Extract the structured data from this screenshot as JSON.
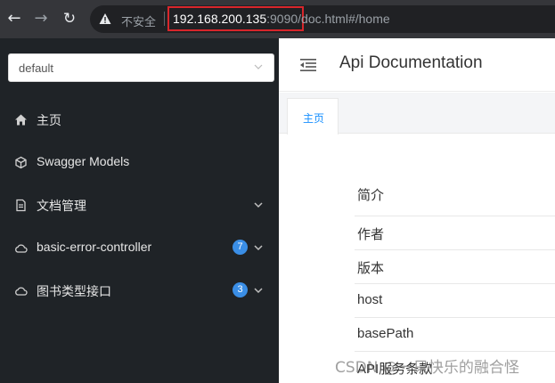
{
  "browser": {
    "insecure_label": "不安全",
    "url_host": "192.168.200.135",
    "url_port": ":9090",
    "url_path": "/doc.html#/home"
  },
  "sidebar": {
    "group_select_value": "default",
    "items": [
      {
        "label": "主页",
        "icon": "home-icon"
      },
      {
        "label": "Swagger Models",
        "icon": "cube-icon"
      },
      {
        "label": "文档管理",
        "icon": "document-icon",
        "expandable": true
      },
      {
        "label": "basic-error-controller",
        "icon": "cloud-icon",
        "badge": "7",
        "expandable": true
      },
      {
        "label": "图书类型接口",
        "icon": "cloud-icon",
        "badge": "3",
        "expandable": true
      }
    ]
  },
  "main": {
    "title": "Api Documentation",
    "tabs": [
      {
        "label": "主页"
      }
    ],
    "info_rows": [
      {
        "label": "简介"
      },
      {
        "label": "作者"
      },
      {
        "label": "版本"
      },
      {
        "label": "host"
      },
      {
        "label": "basePath"
      },
      {
        "label": "API服务条款"
      }
    ]
  },
  "watermark": "CSDN @一只快乐的融合怪",
  "colors": {
    "sidebar_bg": "#1f2327",
    "badge": "#3a8ee6",
    "tab_active": "#1890ff",
    "url_highlight": "#d8262b"
  }
}
